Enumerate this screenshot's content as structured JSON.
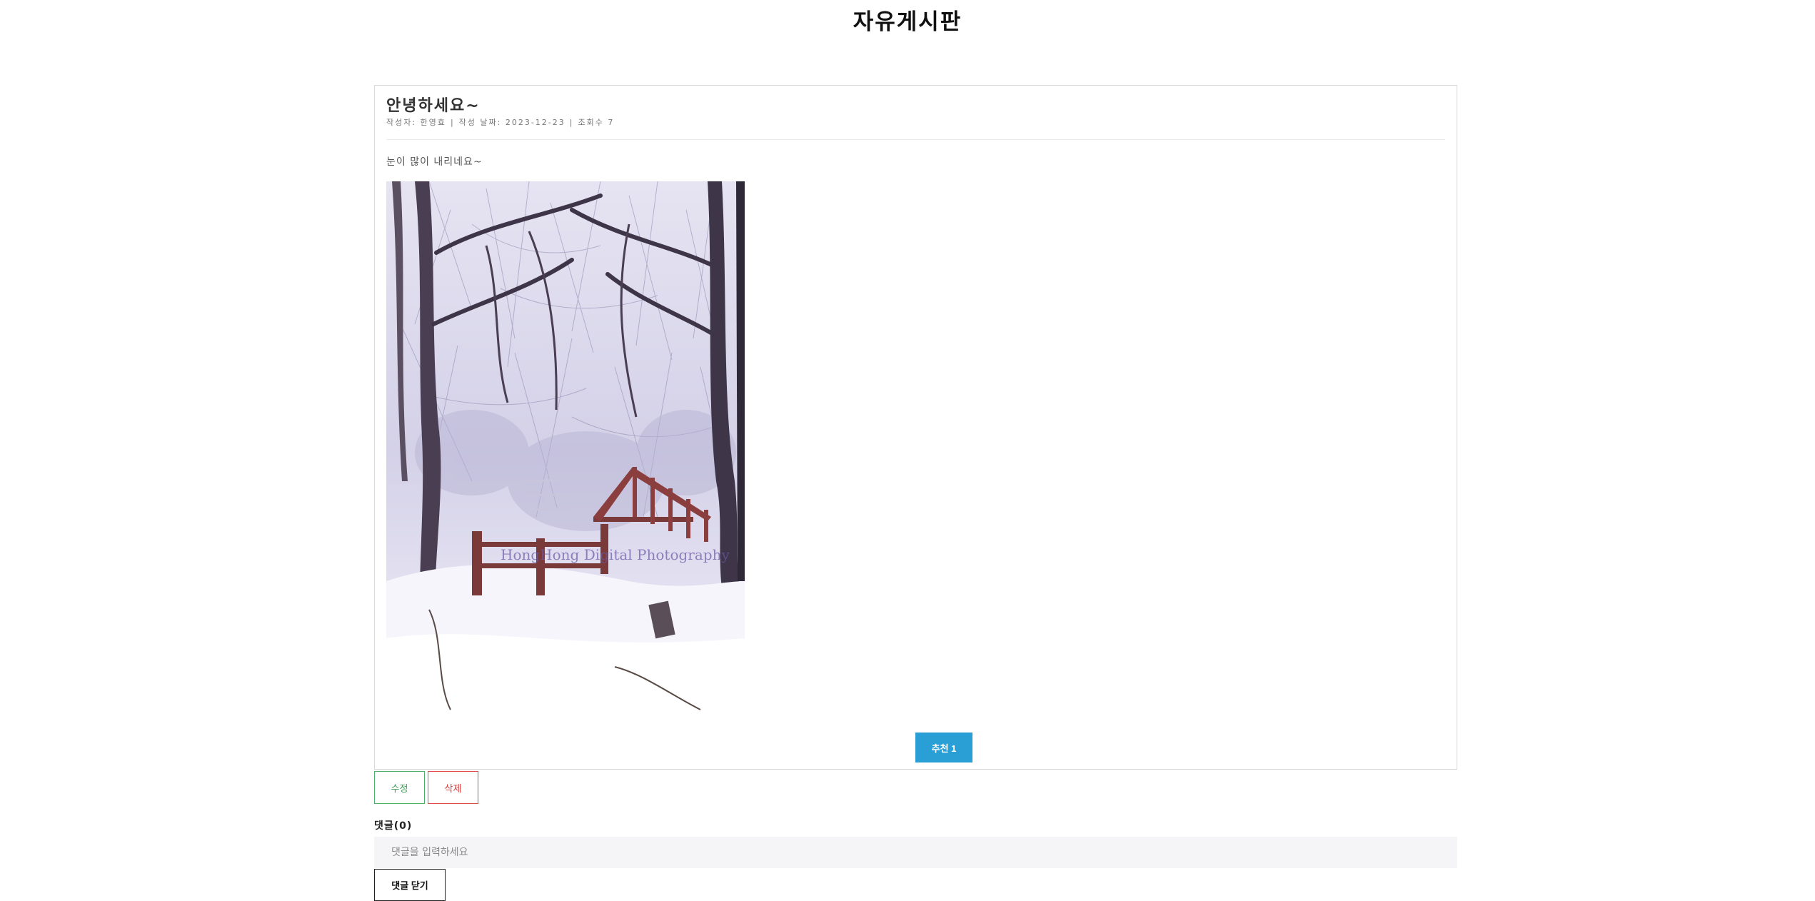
{
  "page": {
    "title": "자유게시판"
  },
  "post": {
    "title": "안녕하세요~",
    "meta": {
      "author": "작성자: 한영효",
      "date": "작성 날짜: 2023-12-23",
      "views": "조회수 7",
      "separator": "|"
    },
    "body": "눈이 많이 내리네요~",
    "image_watermark": "HongHong Digital Photography",
    "recommend_label": "추천 1"
  },
  "actions": {
    "edit_label": "수정",
    "delete_label": "삭제"
  },
  "comments": {
    "label": "댓글(0)",
    "input_placeholder": "댓글을 입력하세요",
    "close_label": "댓글 닫기"
  },
  "colors": {
    "recommend": "#2a9fd6",
    "edit": "#3a9d55",
    "delete": "#d63a3a"
  }
}
